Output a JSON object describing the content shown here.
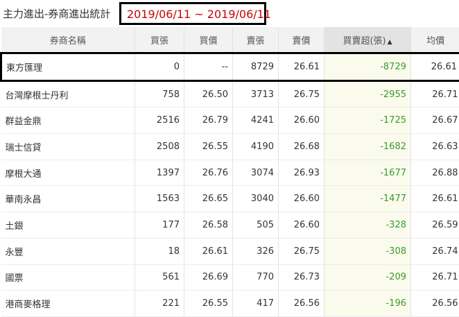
{
  "title": "主力進出-券商進出統計",
  "date_range": "2019/06/11 ~ 2019/06/11",
  "columns": {
    "broker": "券商名稱",
    "buy_volume": "買張",
    "buy_price": "買價",
    "sell_volume": "賣張",
    "sell_price": "賣價",
    "net": "買賣超(張)",
    "avg_price": "均價"
  },
  "sort_indicator": "▲",
  "colors": {
    "date": "#cc0000",
    "net_negative": "#3c9a2e",
    "net_bg": "#fafbec"
  },
  "rows": [
    {
      "broker": "東方匯理",
      "buy_volume": "0",
      "buy_price": "--",
      "sell_volume": "8729",
      "sell_price": "26.61",
      "net": "-8729",
      "avg_price": "26.61"
    },
    {
      "broker": "台灣摩根士丹利",
      "buy_volume": "758",
      "buy_price": "26.50",
      "sell_volume": "3713",
      "sell_price": "26.75",
      "net": "-2955",
      "avg_price": "26.71"
    },
    {
      "broker": "群益金鼎",
      "buy_volume": "2516",
      "buy_price": "26.79",
      "sell_volume": "4241",
      "sell_price": "26.60",
      "net": "-1725",
      "avg_price": "26.67"
    },
    {
      "broker": "瑞士信貸",
      "buy_volume": "2508",
      "buy_price": "26.55",
      "sell_volume": "4190",
      "sell_price": "26.68",
      "net": "-1682",
      "avg_price": "26.63"
    },
    {
      "broker": "摩根大通",
      "buy_volume": "1397",
      "buy_price": "26.76",
      "sell_volume": "3074",
      "sell_price": "26.93",
      "net": "-1677",
      "avg_price": "26.88"
    },
    {
      "broker": "華南永昌",
      "buy_volume": "1563",
      "buy_price": "26.65",
      "sell_volume": "3040",
      "sell_price": "26.60",
      "net": "-1477",
      "avg_price": "26.61"
    },
    {
      "broker": "土銀",
      "buy_volume": "177",
      "buy_price": "26.58",
      "sell_volume": "505",
      "sell_price": "26.60",
      "net": "-328",
      "avg_price": "26.59"
    },
    {
      "broker": "永豐",
      "buy_volume": "18",
      "buy_price": "26.61",
      "sell_volume": "326",
      "sell_price": "26.75",
      "net": "-308",
      "avg_price": "26.74"
    },
    {
      "broker": "國票",
      "buy_volume": "561",
      "buy_price": "26.69",
      "sell_volume": "770",
      "sell_price": "26.73",
      "net": "-209",
      "avg_price": "26.71"
    },
    {
      "broker": "港商麥格理",
      "buy_volume": "221",
      "buy_price": "26.55",
      "sell_volume": "417",
      "sell_price": "26.56",
      "net": "-196",
      "avg_price": "26.56"
    }
  ]
}
